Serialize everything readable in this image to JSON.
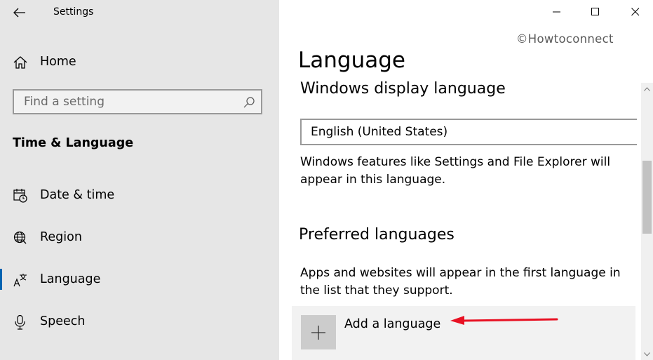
{
  "window": {
    "title": "Settings",
    "controls": [
      "minimize",
      "maximize",
      "close"
    ]
  },
  "sidebar": {
    "home_label": "Home",
    "search_placeholder": "Find a setting",
    "section_heading": "Time & Language",
    "items": [
      {
        "label": "Date & time",
        "icon": "calendar-clock-icon"
      },
      {
        "label": "Region",
        "icon": "globe-icon"
      },
      {
        "label": "Language",
        "icon": "language-icon",
        "active": true
      },
      {
        "label": "Speech",
        "icon": "microphone-icon"
      }
    ]
  },
  "main": {
    "watermark": "©Howtoconnect",
    "page_title": "Language",
    "display_language": {
      "heading": "Windows display language",
      "selected": "English (United States)",
      "description": "Windows features like Settings and File Explorer will appear in this language."
    },
    "preferred": {
      "heading": "Preferred languages",
      "description": "Apps and websites will appear in the first language in the list that they support.",
      "add_label": "Add a language"
    }
  },
  "colors": {
    "sidebar_bg": "#e6e6e6",
    "accent": "#0063b1",
    "annotation_arrow": "#e81123"
  }
}
